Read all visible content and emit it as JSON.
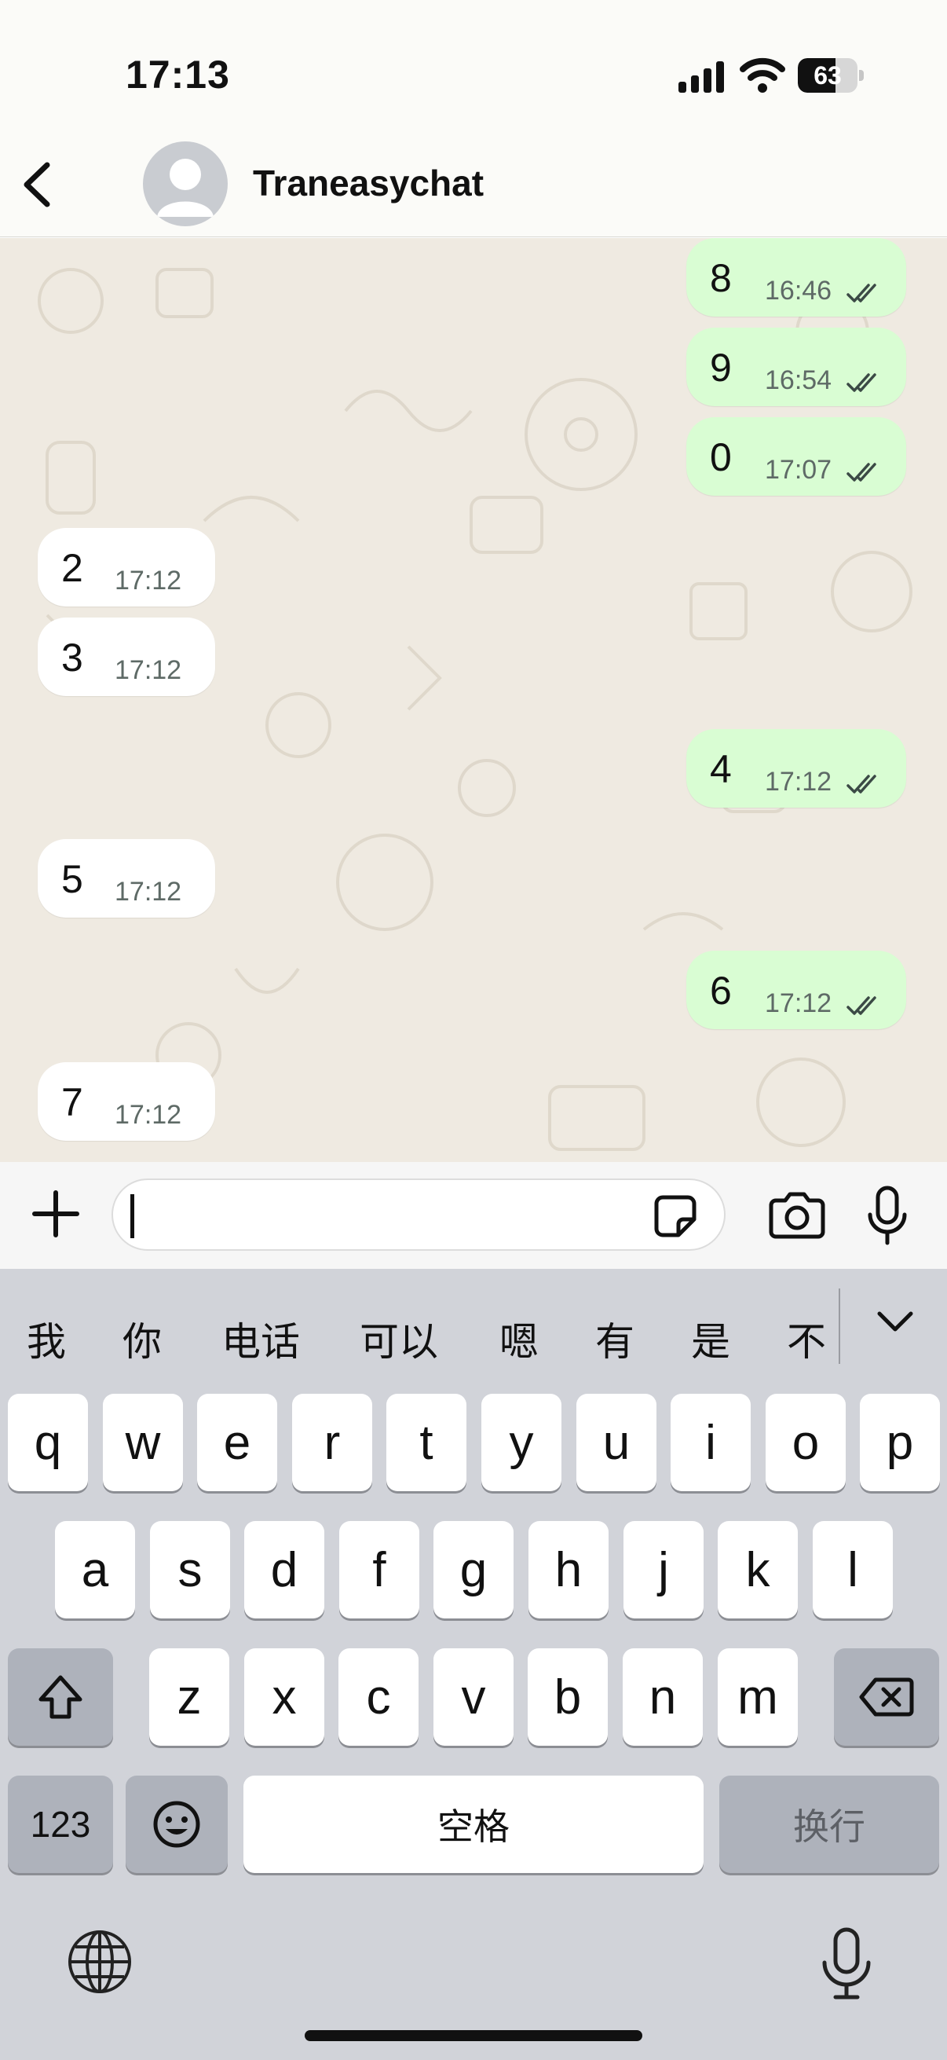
{
  "status_bar": {
    "time": "17:13",
    "battery": "63"
  },
  "header": {
    "contact_name": "Traneasychat"
  },
  "messages": [
    {
      "dir": "out",
      "text": "8",
      "time": "16:46",
      "ticks": true
    },
    {
      "dir": "out",
      "text": "9",
      "time": "16:54",
      "ticks": true
    },
    {
      "dir": "out",
      "text": "0",
      "time": "17:07",
      "ticks": true
    },
    {
      "dir": "in",
      "text": "2",
      "time": "17:12"
    },
    {
      "dir": "in",
      "text": "3",
      "time": "17:12"
    },
    {
      "dir": "out",
      "text": "4",
      "time": "17:12",
      "ticks": true
    },
    {
      "dir": "in",
      "text": "5",
      "time": "17:12"
    },
    {
      "dir": "out",
      "text": "6",
      "time": "17:12",
      "ticks": true
    },
    {
      "dir": "in",
      "text": "7",
      "time": "17:12"
    }
  ],
  "input": {
    "value": "",
    "placeholder": ""
  },
  "keyboard": {
    "candidates": [
      "我",
      "你",
      "电话",
      "可以",
      "嗯",
      "有",
      "是",
      "不"
    ],
    "row1": [
      "q",
      "w",
      "e",
      "r",
      "t",
      "y",
      "u",
      "i",
      "o",
      "p"
    ],
    "row2": [
      "a",
      "s",
      "d",
      "f",
      "g",
      "h",
      "j",
      "k",
      "l"
    ],
    "row3": [
      "z",
      "x",
      "c",
      "v",
      "b",
      "n",
      "m"
    ],
    "numbers_label": "123",
    "space_label": "空格",
    "return_label": "换行"
  },
  "colors": {
    "outgoing_bubble": "#d9fdd3",
    "incoming_bubble": "#ffffff",
    "chat_background": "#efeae1",
    "keyboard_background": "#d1d3d9"
  }
}
